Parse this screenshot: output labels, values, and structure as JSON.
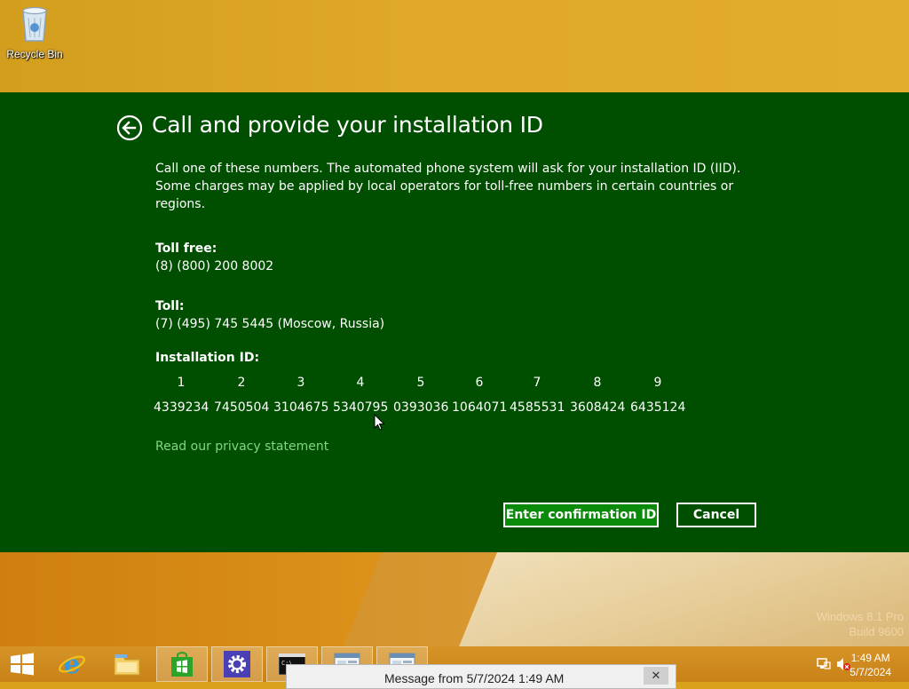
{
  "desktop": {
    "recycle_bin_label": "Recycle Bin",
    "watermark_line1": "Windows 8.1 Pro",
    "watermark_line2": "Build 9600"
  },
  "dialog": {
    "title": "Call and provide your installation ID",
    "description": "Call one of these numbers. The automated phone system will ask for your installation ID (IID). Some charges may be applied by local operators for toll-free numbers in certain countries or regions.",
    "toll_free_heading": "Toll free:",
    "toll_free_number": "(8) (800) 200 8002",
    "toll_heading": "Toll:",
    "toll_number": "(7) (495) 745 5445 (Moscow, Russia)",
    "installation_id_heading": "Installation ID:",
    "installation_id_groups": [
      {
        "n": "1",
        "v": "4339234"
      },
      {
        "n": "2",
        "v": "7450504"
      },
      {
        "n": "3",
        "v": "3104675"
      },
      {
        "n": "4",
        "v": "5340795"
      },
      {
        "n": "5",
        "v": "0393036"
      },
      {
        "n": "6",
        "v": "1064071"
      },
      {
        "n": "7",
        "v": "4585531"
      },
      {
        "n": "8",
        "v": "3608424"
      },
      {
        "n": "9",
        "v": "6435124"
      }
    ],
    "privacy_link": "Read our privacy statement",
    "confirm_button": "Enter confirmation ID",
    "cancel_button": "Cancel"
  },
  "taskbar": {
    "items": [
      "start-button",
      "internet-explorer",
      "file-explorer",
      "store",
      "settings",
      "command-prompt",
      "window-1",
      "window-2"
    ],
    "clock_time": "1:49 AM",
    "clock_date": "5/7/2024"
  },
  "toast": {
    "title": "Message from  5/7/2024 1:49 AM",
    "close": "✕"
  },
  "colors": {
    "dialog_bg": "#004f00",
    "confirm_bg": "#0a8a0a",
    "link": "#7fd87f",
    "desktop_accent": "#dfa829"
  }
}
